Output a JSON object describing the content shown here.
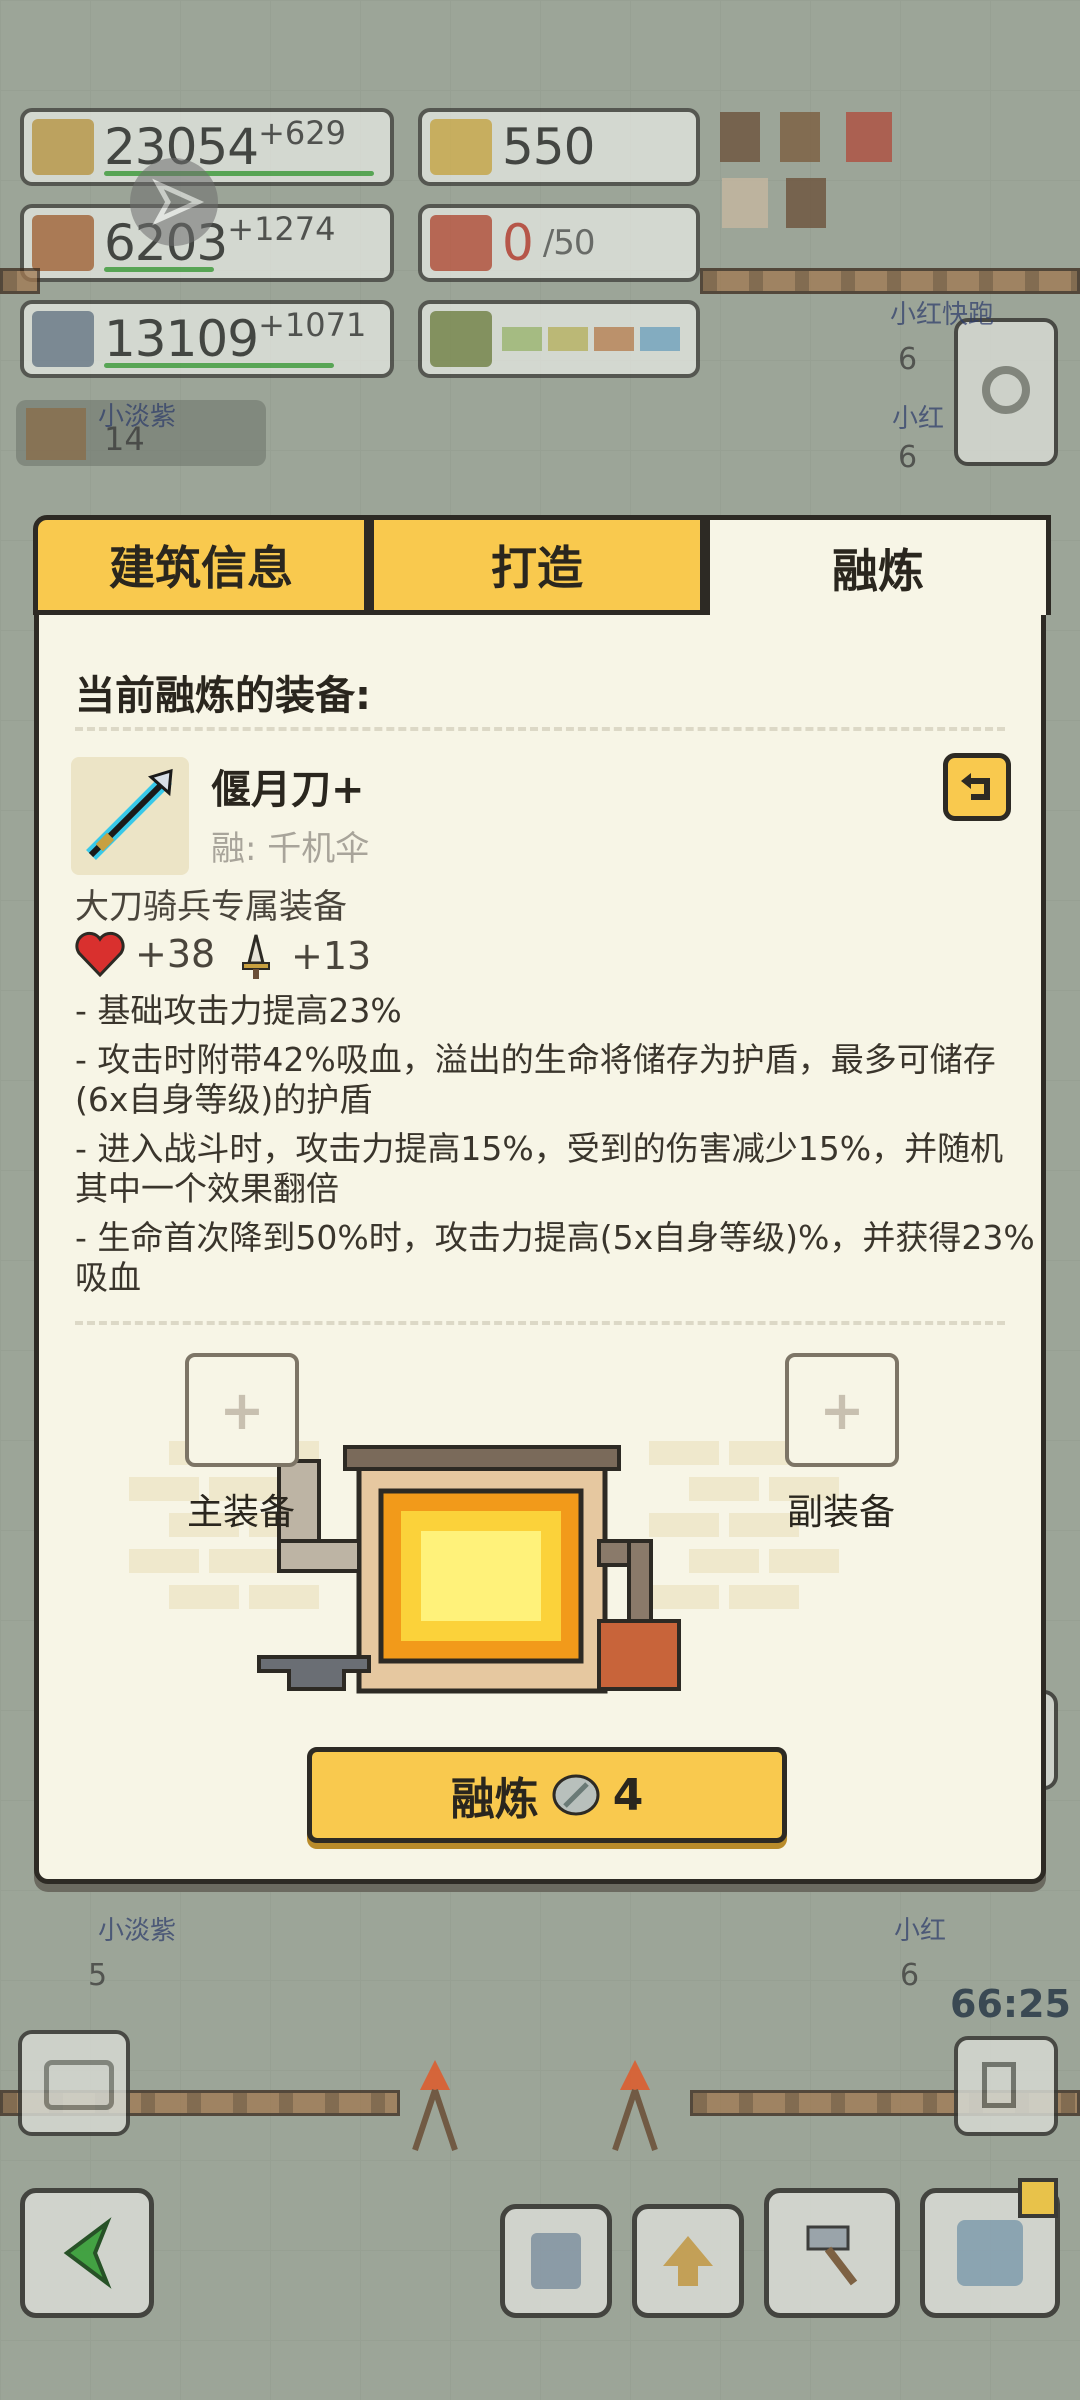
{
  "resources": {
    "wheat": {
      "value": "23054",
      "delta": "+629"
    },
    "gold": {
      "value": "550"
    },
    "wood": {
      "value": "6203",
      "delta": "+1274"
    },
    "gift": {
      "value": "0",
      "max": "/50"
    },
    "stone": {
      "value": "13109",
      "delta": "+1071"
    }
  },
  "background": {
    "tags": [
      "小淡紫",
      "小红快跑",
      "小红",
      "小红",
      "小淡紫",
      "小红",
      "小淡紫"
    ],
    "numbers": [
      "14",
      "6",
      "6",
      "5",
      "6"
    ],
    "timer": "66:25"
  },
  "panel": {
    "tabs": [
      "建筑信息",
      "打造",
      "融炼"
    ],
    "active_tab": "融炼",
    "section_title": "当前融炼的装备:",
    "item": {
      "name": "偃月刀+",
      "fused_with": "融: 千机伞",
      "exclusive": "大刀骑兵专属装备",
      "hp": "+38",
      "atk": "+13"
    },
    "effects": [
      "- 基础攻击力提高23%",
      "- 攻击时附带42%吸血，溢出的生命将储存为护盾，最多可储存(6x自身等级)的护盾",
      "- 进入战斗时，攻击力提高15%，受到的伤害减少15%，并随机其中一个效果翻倍",
      "- 生命首次降到50%时，攻击力提高(5x自身等级)%，并获得23%吸血"
    ],
    "main_slot_label": "主装备",
    "sub_slot_label": "副装备",
    "fuse_button": {
      "label": "融炼",
      "cost": "4"
    }
  },
  "colors": {
    "accent": "#f9c94e",
    "panel_bg": "#f7f5e6",
    "heart": "#d9302e"
  }
}
